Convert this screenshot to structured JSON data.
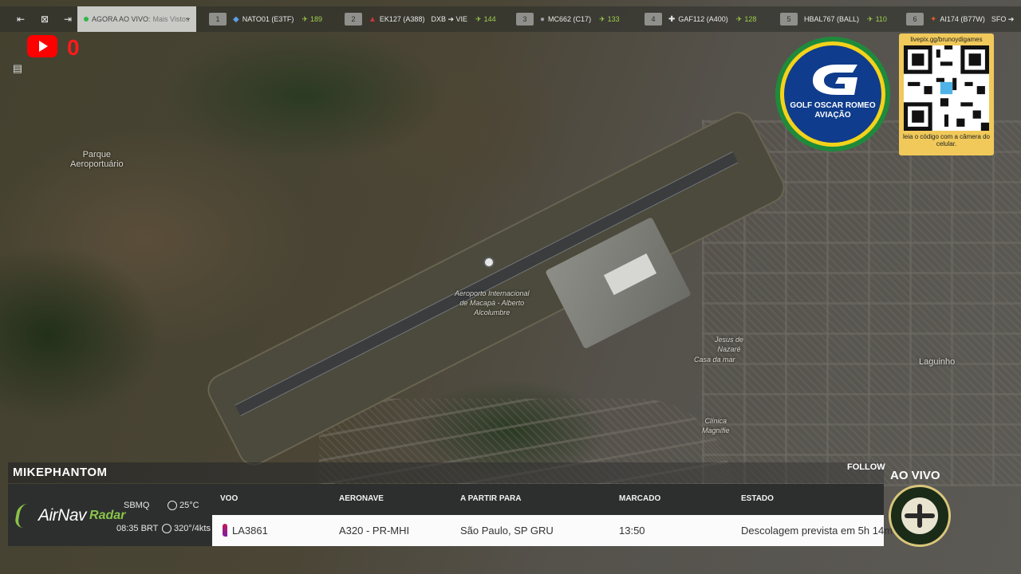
{
  "topbar": {
    "live_label": "AGORA AO VIVO:",
    "live_sub": "Mais Vistos",
    "flights": [
      {
        "rank": "1",
        "callsign": "NATO01 (E3TF)",
        "route": "",
        "viewers": "189"
      },
      {
        "rank": "2",
        "callsign": "EK127 (A388)",
        "route": "DXB ➔ VIE",
        "viewers": "144"
      },
      {
        "rank": "3",
        "callsign": "MC662 (C17)",
        "route": "",
        "viewers": "133"
      },
      {
        "rank": "4",
        "callsign": "GAF112 (A400)",
        "route": "",
        "viewers": "128"
      },
      {
        "rank": "5",
        "callsign": "HBAL767 (BALL)",
        "route": "",
        "viewers": "110"
      },
      {
        "rank": "6",
        "callsign": "AI174 (B77W)",
        "route": "SFO ➔",
        "viewers": ""
      }
    ]
  },
  "youtube": {
    "count": "0"
  },
  "map": {
    "labels": {
      "park": "Parque\nAeroportuário",
      "airport": "Aeroporto Internacional\nde Macapá - Alberto\nAlcolumbre",
      "jesus": "Jesus de\nNazaré",
      "laguinho": "Laguinho",
      "canal": "Casa da mar",
      "clinic": "Clínica\nMagnífie"
    }
  },
  "logo": {
    "line1": "GOLF OSCAR ROMEO",
    "line2": "AVIAÇÃO"
  },
  "qr": {
    "url": "livepix.gg/brunoydigames",
    "caption": "leia o código com a câmera do celular."
  },
  "panel": {
    "username": "MIKEPHANTOM",
    "follow": "FOLLOW",
    "brand_name": "AirNav",
    "brand_suffix": "Radar",
    "station": "SBMQ",
    "local_time": "08:35 BRT",
    "temperature": "25°C",
    "wind": "320°/4kts",
    "headers": {
      "flight": "VOO",
      "aircraft": "AERONAVE",
      "from_to": "A PARTIR PARA",
      "scheduled": "MARCADO",
      "status": "ESTADO"
    },
    "row": {
      "flight": "LA3861",
      "aircraft": "A320 - PR-MHI",
      "from_to": "São Paulo, SP GRU",
      "scheduled": "13:50",
      "status": "Descolagem prevista em 5h 14m"
    }
  },
  "ao_vivo": "AO VIVO",
  "colors": {
    "viewers": "#9fd04c",
    "youtube": "#ff0000",
    "airnav_green": "#8bc34a"
  }
}
